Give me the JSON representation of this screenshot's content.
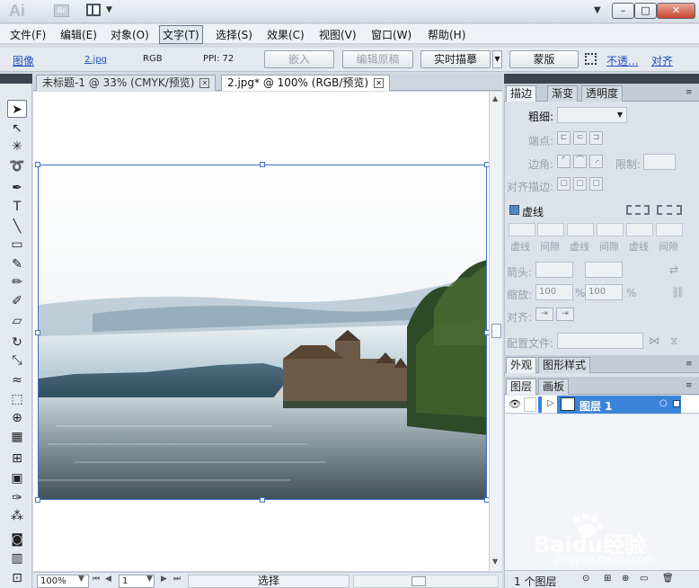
{
  "titlebar": {
    "app_logo": "Ai",
    "bridge_label": "Br",
    "minimize": "–",
    "maximize": "□",
    "close": "✕",
    "dropdown_arrow": "▼"
  },
  "menu": [
    "文件(F)",
    "编辑(E)",
    "对象(O)",
    "文字(T)",
    "选择(S)",
    "效果(C)",
    "视图(V)",
    "窗口(W)",
    "帮助(H)"
  ],
  "control": {
    "object_type": "图像",
    "filename": "2.jpg",
    "color_mode": "RGB",
    "ppi": "PPI: 72",
    "embed_button": "嵌入",
    "edit_original_button": "编辑原稿",
    "live_trace_button": "实时描摹",
    "mask_button": "蒙版",
    "opacity_link": "不透...",
    "align_link": "对齐"
  },
  "tabs": {
    "tab1": "未标题-1 @ 33% (CMYK/预览)",
    "tab2": "2.jpg* @ 100% (RGB/预览)",
    "close": "✕"
  },
  "status": {
    "zoom": "100%",
    "page": "1",
    "mode": "选择"
  },
  "stroke_panel": {
    "tabs": [
      "描边",
      "渐变",
      "透明度"
    ],
    "weight_label": "粗细:",
    "cap_label": "端点:",
    "corner_label": "边角:",
    "limit_label": "限制:",
    "align_label": "对齐描边:",
    "dashed_label": "虚线",
    "dash_labels": [
      "虚线",
      "间隙",
      "虚线",
      "间隙",
      "虚线",
      "间隙"
    ],
    "arrow_label": "箭头:",
    "scale_label": "缩放:",
    "scale_value_1": "100",
    "scale_value_2": "100",
    "percent": "%",
    "align_label2": "对齐:",
    "profile_label": "配置文件:"
  },
  "appearance_panel": {
    "tabs": [
      "外观",
      "图形样式"
    ]
  },
  "layers_panel": {
    "tabs": [
      "图层",
      "画板"
    ],
    "layer_name": "图层 1",
    "footer": "1 个图层"
  },
  "watermark": {
    "brand": "Baidu经验",
    "url": "jingyan.baidu.com"
  }
}
